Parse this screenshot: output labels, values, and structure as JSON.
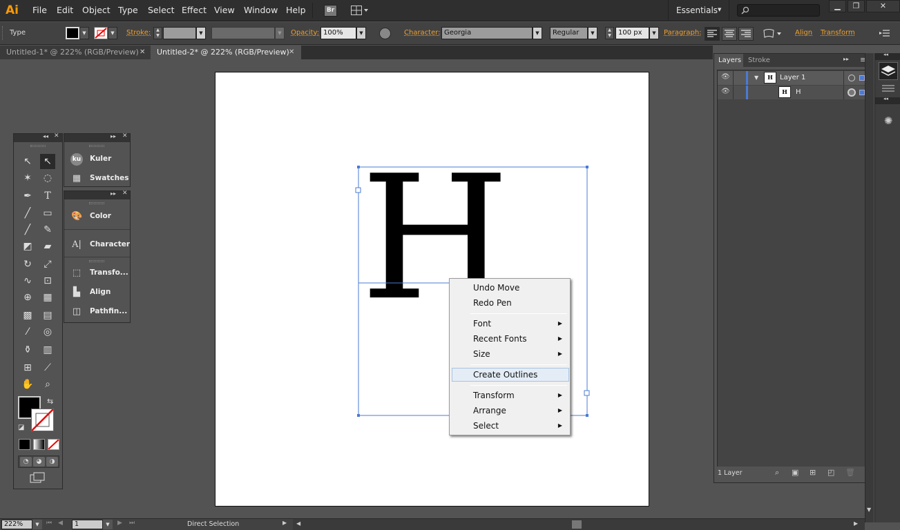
{
  "app": {
    "logo": "Ai"
  },
  "menu": [
    "File",
    "Edit",
    "Object",
    "Type",
    "Select",
    "Effect",
    "View",
    "Window",
    "Help"
  ],
  "bridge_label": "Br",
  "workspace": {
    "label": "Essentials"
  },
  "control": {
    "tool_name": "Type",
    "stroke_label": "Stroke:",
    "opacity_label": "Opacity:",
    "opacity_value": "100%",
    "character_label": "Character:",
    "font_value": "Georgia",
    "style_value": "Regular",
    "size_value": "100 px",
    "paragraph_label": "Paragraph:",
    "align_label": "Align",
    "transform_label": "Transform"
  },
  "tabs": [
    {
      "label": "Untitled-1* @ 222% (RGB/Preview)"
    },
    {
      "label": "Untitled-2* @ 222% (RGB/Preview)"
    }
  ],
  "canvas": {
    "glyph": "H"
  },
  "context_menu": {
    "items": [
      {
        "label": "Undo Move"
      },
      {
        "label": "Redo Pen"
      },
      {
        "label": "Font"
      },
      {
        "label": "Recent Fonts"
      },
      {
        "label": "Size"
      },
      {
        "label": "Create Outlines"
      },
      {
        "label": "Transform"
      },
      {
        "label": "Arrange"
      },
      {
        "label": "Select"
      }
    ]
  },
  "collapsed_panels": {
    "kuler_icon_text": "ku",
    "items": [
      "Kuler",
      "Swatches",
      "Color",
      "Character",
      "Transfo...",
      "Align",
      "Pathfin..."
    ]
  },
  "layers_panel": {
    "tabs": [
      "Layers",
      "Stroke"
    ],
    "layer_name": "Layer 1",
    "sublayer_name": "H",
    "thumb_text": "H",
    "footer": "1 Layer"
  },
  "status": {
    "zoom": "222%",
    "artboard": "1",
    "tool": "Direct Selection"
  },
  "colors": {
    "accent": "#f0a030",
    "selection": "#4a7bd4",
    "menu_highlight": "#e4edf6"
  }
}
